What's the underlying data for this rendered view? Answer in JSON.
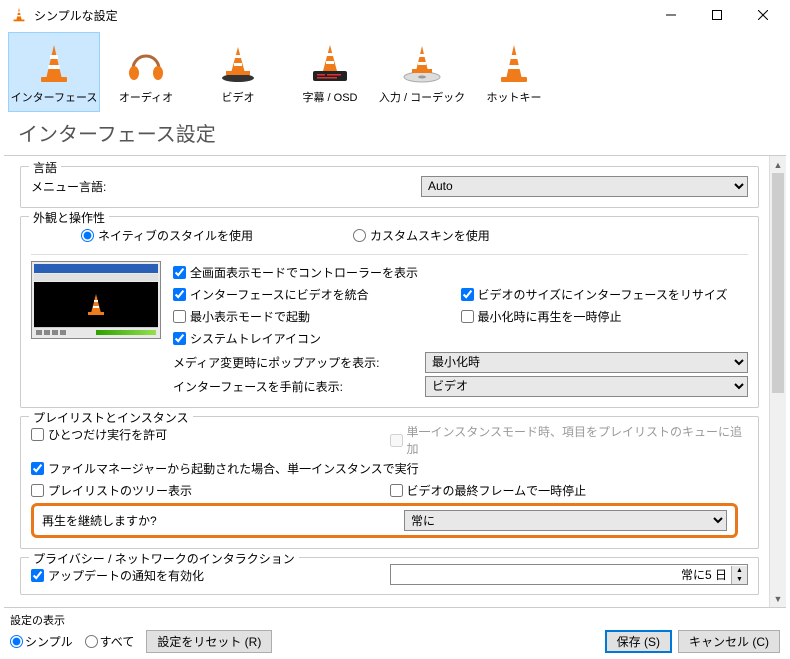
{
  "window": {
    "title": "シンプルな設定"
  },
  "tabs": [
    {
      "label": "インターフェース",
      "icon": "cone"
    },
    {
      "label": "オーディオ",
      "icon": "headphones"
    },
    {
      "label": "ビデオ",
      "icon": "cone"
    },
    {
      "label": "字幕 / OSD",
      "icon": "subtitle"
    },
    {
      "label": "入力 / コーデック",
      "icon": "cone"
    },
    {
      "label": "ホットキー",
      "icon": "cone"
    }
  ],
  "heading": "インターフェース設定",
  "language": {
    "legend": "言語",
    "menu_label": "メニュー言語:",
    "menu_value": "Auto"
  },
  "appearance": {
    "legend": "外観と操作性",
    "radio_native": "ネイティブのスタイルを使用",
    "radio_custom": "カスタムスキンを使用",
    "chk_fullscreen_ctrl": "全画面表示モードでコントローラーを表示",
    "chk_embed_video": "インターフェースにビデオを統合",
    "chk_resize_iface": "ビデオのサイズにインターフェースをリサイズ",
    "chk_min_start": "最小表示モードで起動",
    "chk_pause_min": "最小化時に再生を一時停止",
    "chk_systray": "システムトレイアイコン",
    "popup_label": "メディア変更時にポップアップを表示:",
    "popup_value": "最小化時",
    "front_label": "インターフェースを手前に表示:",
    "front_value": "ビデオ"
  },
  "playlist": {
    "legend": "プレイリストとインスタンス",
    "chk_one_instance": "ひとつだけ実行を許可",
    "chk_enqueue": "単一インスタンスモード時、項目をプレイリストのキューに追加",
    "chk_filemgr": "ファイルマネージャーから起動された場合、単一インスタンスで実行",
    "chk_tree": "プレイリストのツリー表示",
    "chk_pause_last": "ビデオの最終フレームで一時停止",
    "continue_label": "再生を継続しますか?",
    "continue_value": "常に"
  },
  "privacy": {
    "legend": "プライバシー / ネットワークのインタラクション",
    "chk_update": "アップデートの通知を有効化",
    "spin_value": "常に5 日"
  },
  "footer": {
    "settings_display": "設定の表示",
    "radio_simple": "シンプル",
    "radio_all": "すべて",
    "btn_reset": "設定をリセット (R)",
    "btn_save": "保存 (S)",
    "btn_cancel": "キャンセル (C)"
  }
}
